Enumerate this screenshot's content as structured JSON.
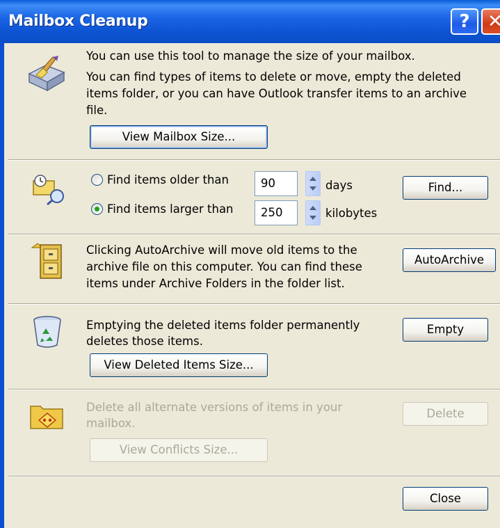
{
  "window": {
    "title": "Mailbox Cleanup",
    "help_label": "?",
    "close_label": "✕"
  },
  "intro": {
    "line1": "You can use this tool to manage the size of your mailbox.",
    "line2": "You can find types of items to delete or move, empty the deleted",
    "line3": "items folder, or you can have Outlook transfer items to an archive",
    "line4": "file.",
    "view_size_button": "View Mailbox Size..."
  },
  "find": {
    "older_label": "Find items older than",
    "older_value": "90",
    "older_unit": "days",
    "larger_label": "Find items larger than",
    "larger_value": "250",
    "larger_unit": "kilobytes",
    "selected_option": "larger",
    "find_button": "Find..."
  },
  "autoarchive": {
    "line1": "Clicking AutoArchive will move old items to the",
    "line2": "archive file on this computer. You can find these",
    "line3": "items under Archive Folders in the folder list.",
    "button": "AutoArchive"
  },
  "deleted": {
    "line1": "Emptying the deleted items folder permanently",
    "line2": "deletes those items.",
    "empty_button": "Empty",
    "view_button": "View Deleted Items Size..."
  },
  "conflicts": {
    "line1": "Delete all alternate versions of items in your",
    "line2": "mailbox.",
    "delete_button": "Delete",
    "view_button": "View Conflicts Size...",
    "enabled": false
  },
  "footer": {
    "close_button": "Close"
  },
  "colors": {
    "titlebar": "#0a4ec6",
    "face": "#ece9d8",
    "disabled_text": "#aca899",
    "button_border": "#003c74"
  }
}
